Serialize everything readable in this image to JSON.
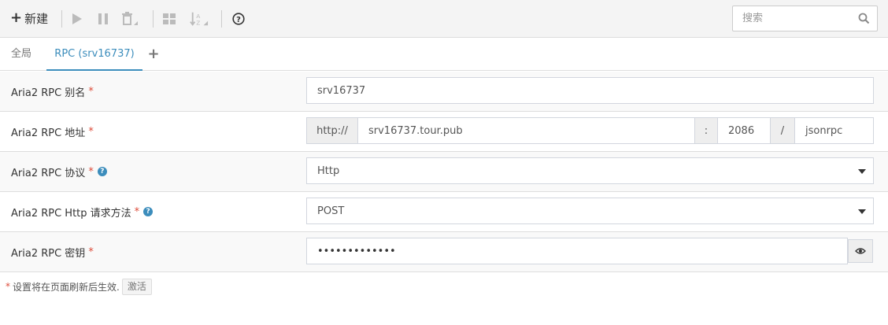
{
  "toolbar": {
    "new_label": "新建",
    "icons": [
      "plus-icon",
      "play-icon",
      "pause-icon",
      "delete-icon",
      "grid-icon",
      "sort-icon",
      "help-icon"
    ]
  },
  "search": {
    "placeholder": "搜索"
  },
  "tabs": [
    {
      "label": "全局",
      "active": false
    },
    {
      "label": "RPC (srv16737)",
      "active": true
    },
    {
      "label": "+",
      "active": false
    }
  ],
  "form": {
    "alias": {
      "label": "Aria2 RPC 别名",
      "required": "*",
      "value": "srv16737"
    },
    "address": {
      "label": "Aria2 RPC 地址",
      "required": "*",
      "protocol_prefix": "http://",
      "host": "srv16737.tour.pub",
      "port_sep": ":",
      "port": "2086",
      "path_sep": "/",
      "path": "jsonrpc"
    },
    "protocol": {
      "label": "Aria2 RPC 协议",
      "required": "*",
      "value": "Http"
    },
    "http_method": {
      "label": "Aria2 RPC Http 请求方法",
      "required": "*",
      "value": "POST"
    },
    "secret": {
      "label": "Aria2 RPC 密钥",
      "required": "*",
      "value": "•••••••••••••"
    }
  },
  "footer": {
    "star": "*",
    "note": "设置将在页面刷新后生效.",
    "activate_label": "激活"
  },
  "colors": {
    "accent": "#3c8dbc",
    "required": "#dd4b39"
  }
}
